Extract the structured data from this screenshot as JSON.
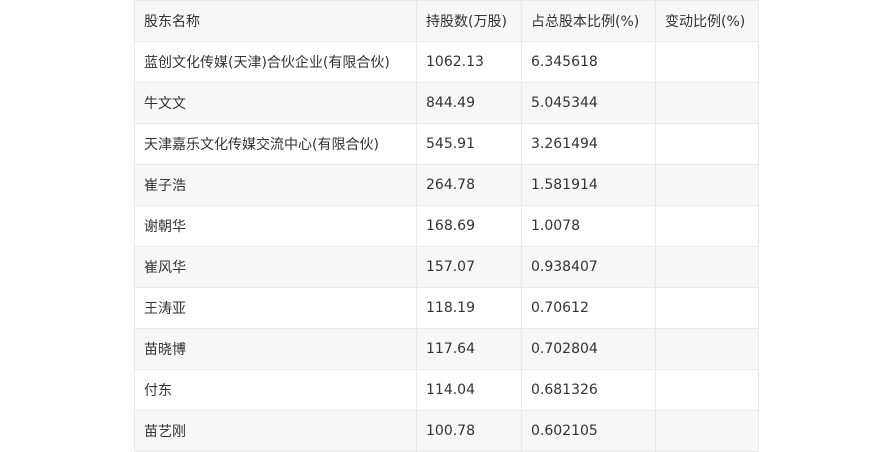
{
  "table": {
    "headers": [
      "股东名称",
      "持股数(万股)",
      "占总股本比例(%)",
      "变动比例(%)"
    ],
    "rows": [
      {
        "name": "蓝创文化传媒(天津)合伙企业(有限合伙)",
        "shares": "1062.13",
        "ratio": "6.345618",
        "change": ""
      },
      {
        "name": "牛文文",
        "shares": "844.49",
        "ratio": "5.045344",
        "change": ""
      },
      {
        "name": "天津嘉乐文化传媒交流中心(有限合伙)",
        "shares": "545.91",
        "ratio": "3.261494",
        "change": ""
      },
      {
        "name": "崔子浩",
        "shares": "264.78",
        "ratio": "1.581914",
        "change": ""
      },
      {
        "name": "谢朝华",
        "shares": "168.69",
        "ratio": "1.0078",
        "change": ""
      },
      {
        "name": "崔风华",
        "shares": "157.07",
        "ratio": "0.938407",
        "change": ""
      },
      {
        "name": "王涛亚",
        "shares": "118.19",
        "ratio": "0.70612",
        "change": ""
      },
      {
        "name": "苗晓博",
        "shares": "117.64",
        "ratio": "0.702804",
        "change": ""
      },
      {
        "name": "付东",
        "shares": "114.04",
        "ratio": "0.681326",
        "change": ""
      },
      {
        "name": "苗艺刚",
        "shares": "100.78",
        "ratio": "0.602105",
        "change": ""
      }
    ]
  }
}
